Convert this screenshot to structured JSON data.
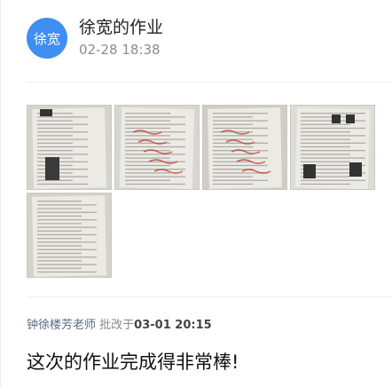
{
  "post": {
    "avatar_text": "徐宽",
    "avatar_color": "#3f8ef2",
    "title": "徐宽的作业",
    "timestamp": "02-28 18:38"
  },
  "attachments": {
    "count": 5,
    "items": [
      {
        "name": "homework-photo-1"
      },
      {
        "name": "homework-photo-2"
      },
      {
        "name": "homework-photo-3"
      },
      {
        "name": "homework-photo-4"
      },
      {
        "name": "homework-photo-5"
      }
    ]
  },
  "review": {
    "teacher": "钟徐楼芳老师",
    "action": "批改于",
    "time": "03-01 20:15",
    "comment": "这次的作业完成得非常棒!"
  }
}
